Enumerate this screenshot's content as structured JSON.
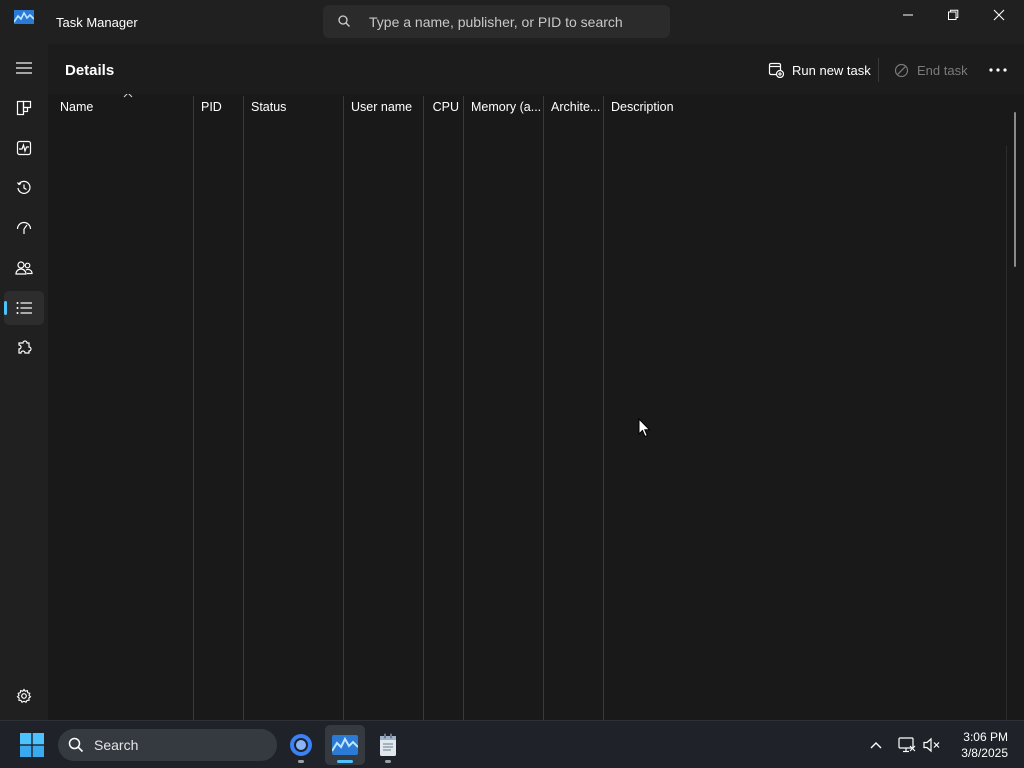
{
  "window": {
    "title": "Task Manager",
    "search_placeholder": "Type a name, publisher, or PID to search"
  },
  "nav": {
    "items": [
      {
        "icon": "hamburger-menu-icon"
      },
      {
        "icon": "processes-icon"
      },
      {
        "icon": "performance-icon"
      },
      {
        "icon": "app-history-icon"
      },
      {
        "icon": "startup-apps-icon"
      },
      {
        "icon": "users-icon"
      },
      {
        "icon": "details-icon",
        "active": true
      },
      {
        "icon": "services-icon"
      }
    ],
    "settings_icon": "settings-gear-icon"
  },
  "page": {
    "title": "Details",
    "run_new_task": "Run new task",
    "end_task": "End task"
  },
  "table": {
    "columns": [
      "Name",
      "PID",
      "Status",
      "User name",
      "CPU",
      "Memory (a...",
      "Archite...",
      "Description"
    ],
    "sorted_column": "Name",
    "rows": []
  },
  "taskbar": {
    "search_label": "Search",
    "apps": [
      {
        "name": "chrome-icon",
        "active": false
      },
      {
        "name": "task-manager-icon",
        "active": true
      },
      {
        "name": "notepad-icon",
        "active": false
      }
    ],
    "time": "3:06 PM",
    "date": "3/8/2025"
  },
  "colors": {
    "accent": "#4cc2ff",
    "background": "#191919",
    "titlebar": "#202020",
    "taskbar": "#1f2329"
  }
}
